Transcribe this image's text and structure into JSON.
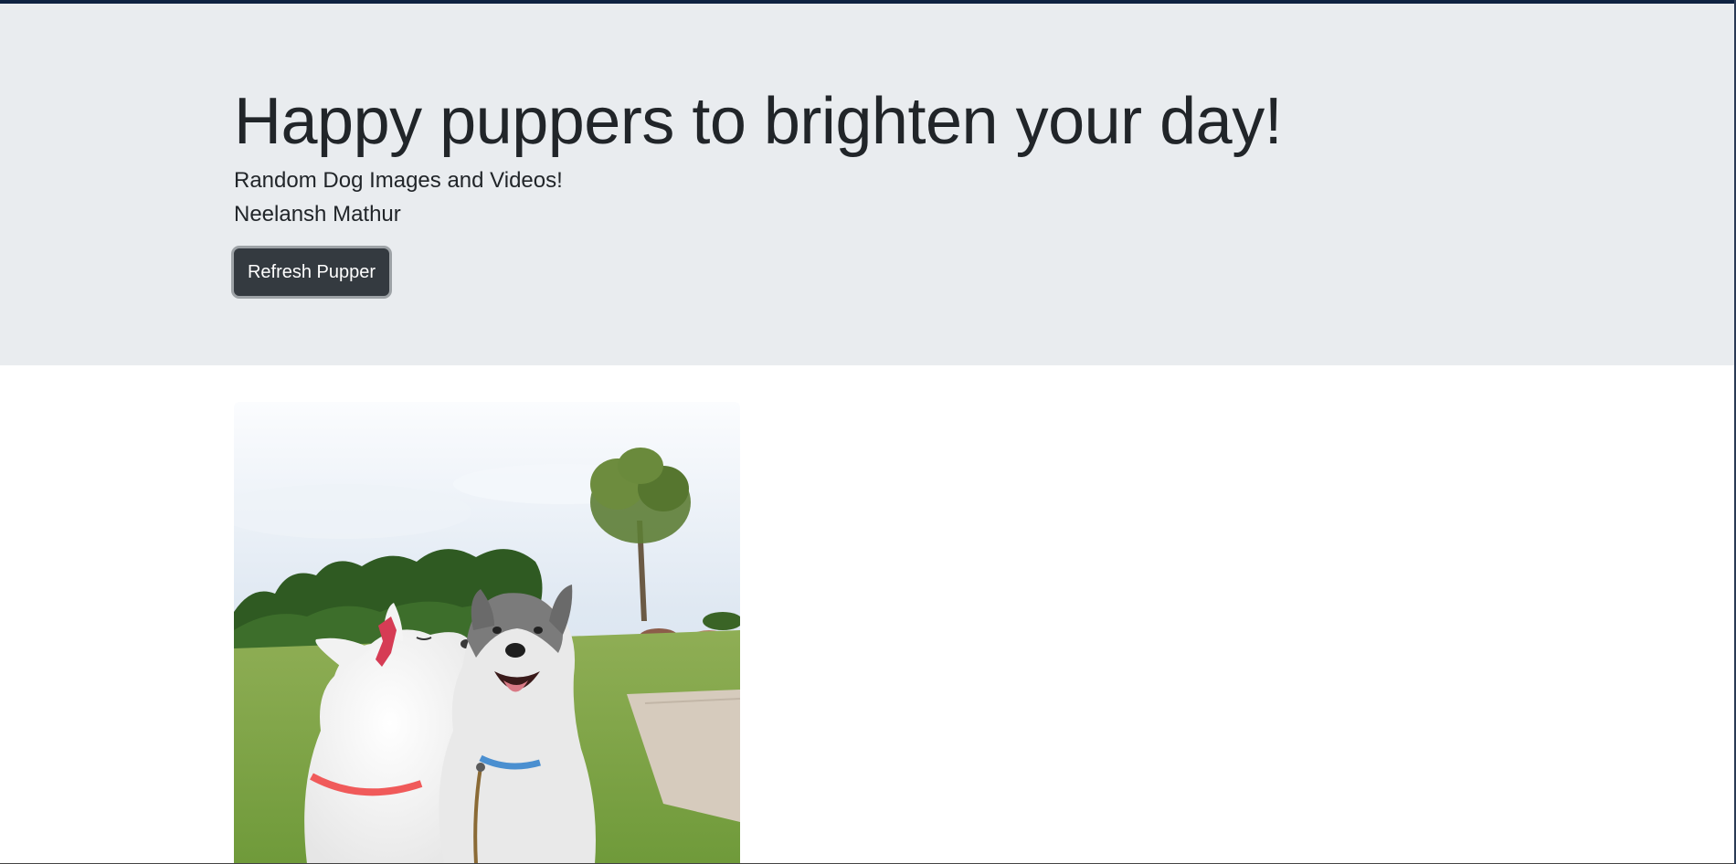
{
  "page": {
    "title": "Happy puppers to brighten your day!",
    "subtitle": "Random Dog Images and Videos!",
    "author": "Neelansh Mathur"
  },
  "actions": {
    "refresh_label": "Refresh Pupper"
  },
  "colors": {
    "jumbotron_bg": "#e9ecef",
    "button_bg": "#343a40",
    "text": "#212529",
    "top_border": "#0f2341"
  },
  "media": {
    "image_alt": "Two huskies: a white husky with a red bow kissing a smiling grey and white husky in a park"
  }
}
